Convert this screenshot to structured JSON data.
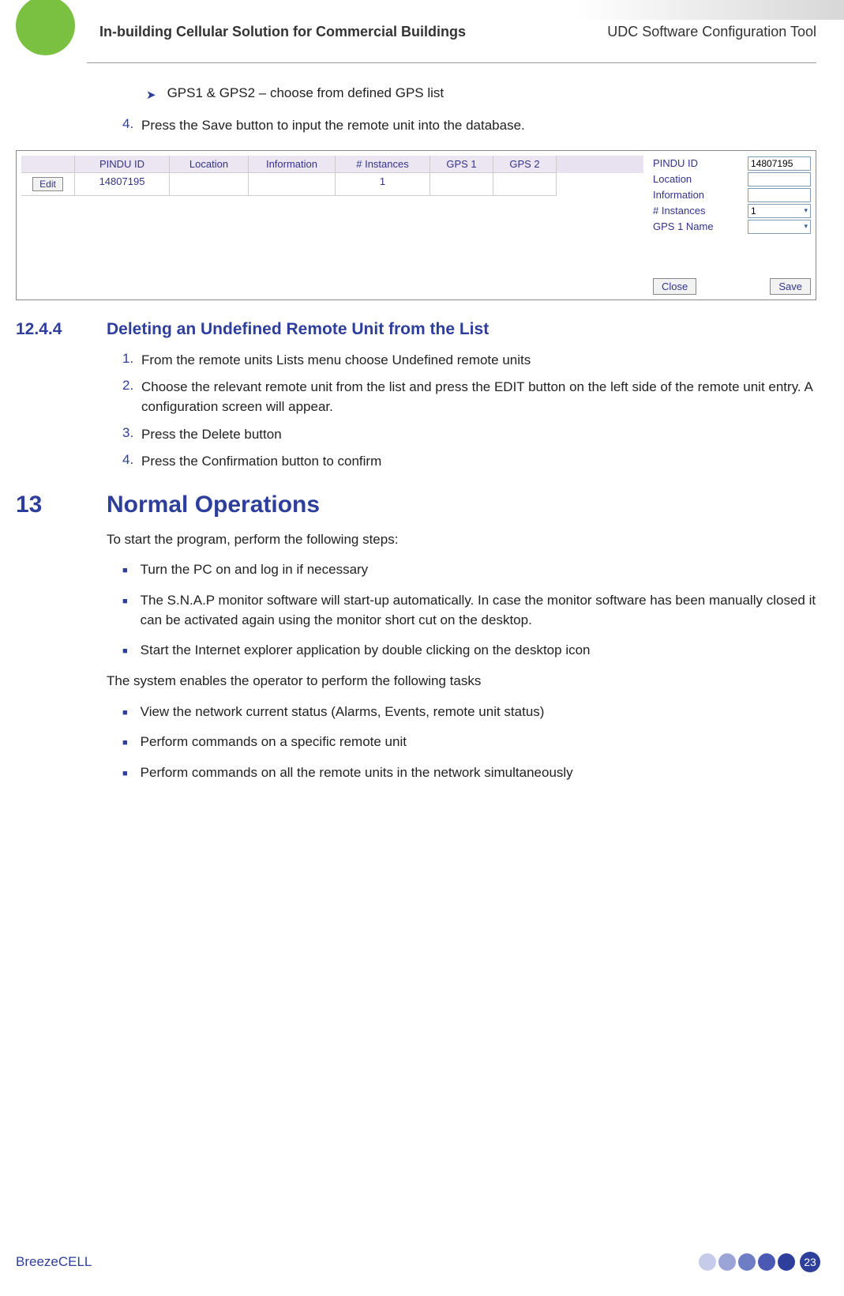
{
  "header": {
    "left": "In-building Cellular Solution for Commercial Buildings",
    "right": "UDC Software Configuration Tool"
  },
  "intro": {
    "arrow_item": "GPS1 & GPS2 – choose from defined GPS list",
    "step4_num": "4.",
    "step4_text": "Press the Save button to input the remote unit into the database."
  },
  "grid": {
    "headers": [
      "PINDU ID",
      "Location",
      "Information",
      "# Instances",
      "GPS 1",
      "GPS 2"
    ],
    "edit_label": "Edit",
    "row": [
      "14807195",
      "",
      "",
      "1",
      "",
      ""
    ]
  },
  "panel": {
    "rows": [
      {
        "label": "PINDU ID",
        "value": "14807195",
        "type": "text"
      },
      {
        "label": "Location",
        "value": "",
        "type": "text"
      },
      {
        "label": "Information",
        "value": "",
        "type": "text"
      },
      {
        "label": "# Instances",
        "value": "1",
        "type": "select"
      },
      {
        "label": "GPS 1 Name",
        "value": "",
        "type": "select"
      }
    ],
    "close": "Close",
    "save": "Save"
  },
  "sec1244": {
    "num": "12.4.4",
    "title": "Deleting an Undefined Remote Unit from the List",
    "steps": [
      {
        "n": "1.",
        "t": "From the remote units Lists menu choose Undefined remote units"
      },
      {
        "n": "2.",
        "t": "Choose the relevant remote unit from the list and press the EDIT button on the left side of the remote unit entry. A configuration screen will appear."
      },
      {
        "n": "3.",
        "t": "Press the Delete button"
      },
      {
        "n": "4.",
        "t": "Press the Confirmation button to confirm"
      }
    ]
  },
  "sec13": {
    "num": "13",
    "title": "Normal Operations",
    "intro1": "To start the program, perform the following steps:",
    "bullets1": [
      "Turn the PC on and log in if necessary",
      "The S.N.A.P monitor software will start-up automatically. In case the monitor software has been manually closed it can be activated again using the monitor short cut on the desktop.",
      "Start the Internet explorer application by double clicking on the desktop icon"
    ],
    "intro2": "The system enables the operator to perform the following tasks",
    "bullets2": [
      "View the network current status (Alarms, Events, remote unit status)",
      "Perform commands on a specific remote unit",
      "Perform commands on all the remote units in the network simultaneously"
    ]
  },
  "footer": {
    "brand": "BreezeCELL",
    "page": "23"
  }
}
